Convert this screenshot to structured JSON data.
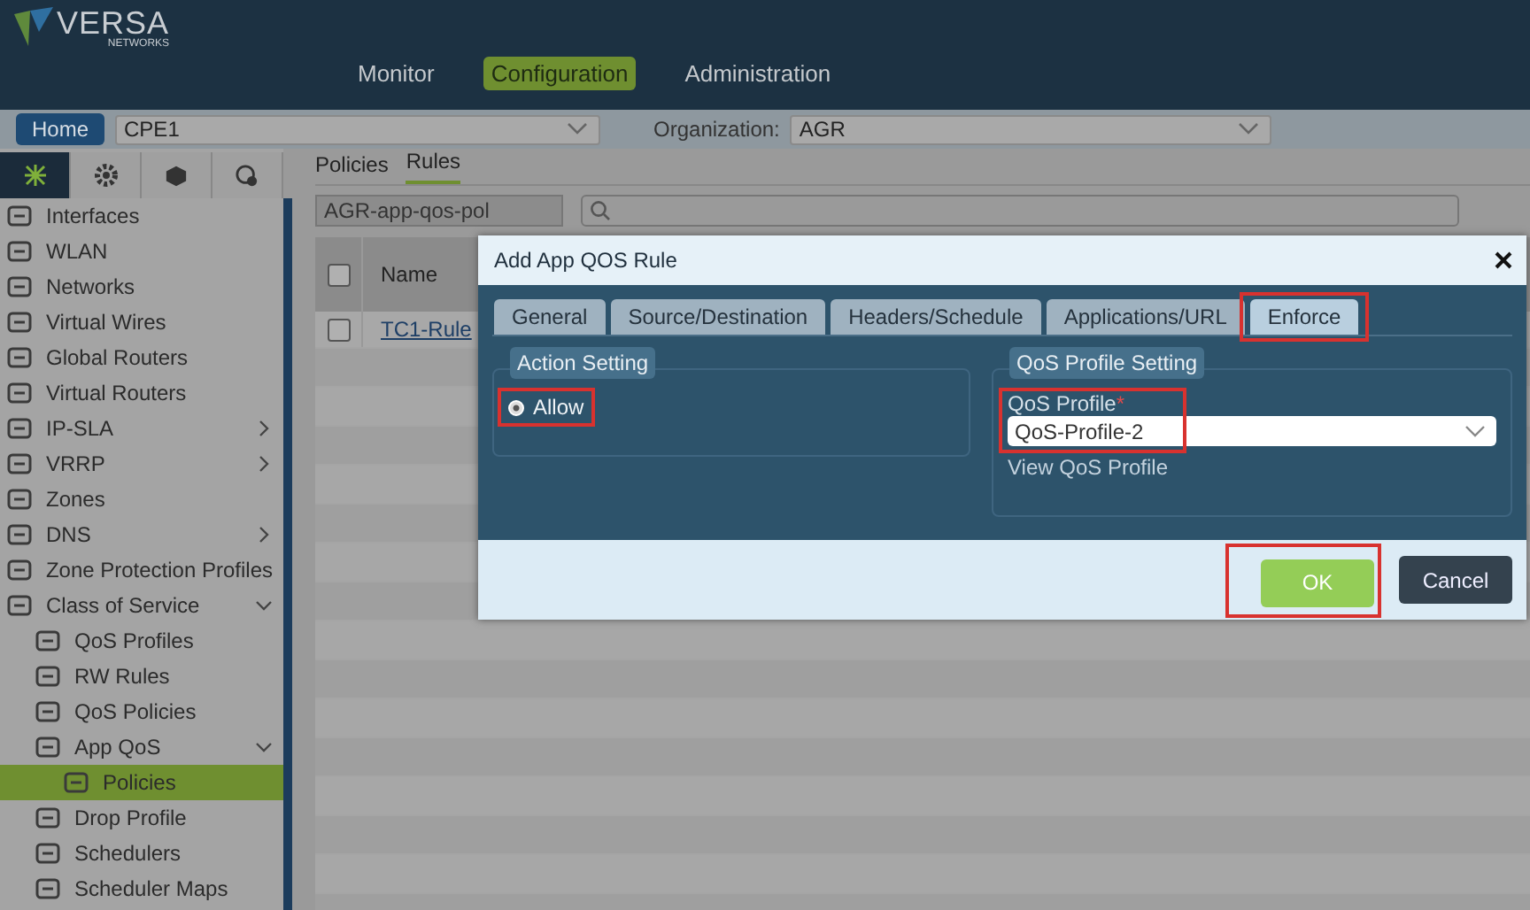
{
  "logo": {
    "name": "VERSA",
    "tagline": "NETWORKS"
  },
  "nav": [
    {
      "label": "Monitor",
      "selected": false
    },
    {
      "label": "Configuration",
      "selected": true
    },
    {
      "label": "Administration",
      "selected": false
    }
  ],
  "toolbar": {
    "home": "Home",
    "device": "CPE1",
    "organization_label": "Organization:",
    "organization": "AGR"
  },
  "sidebar": {
    "icon_tabs": [
      {
        "selected": true
      },
      {
        "selected": false
      },
      {
        "selected": false
      },
      {
        "selected": false
      }
    ],
    "items": [
      {
        "label": "Interfaces",
        "selected": false
      },
      {
        "label": "WLAN",
        "selected": false
      },
      {
        "label": "Networks",
        "selected": false
      },
      {
        "label": "Virtual Wires",
        "selected": false
      },
      {
        "label": "Global Routers",
        "selected": false
      },
      {
        "label": "Virtual Routers",
        "selected": false
      },
      {
        "label": "IP-SLA",
        "selected": false,
        "expanded": false
      },
      {
        "label": "VRRP",
        "selected": false,
        "expanded": false
      },
      {
        "label": "Zones",
        "selected": false
      },
      {
        "label": "DNS",
        "selected": false,
        "expanded": false
      },
      {
        "label": "Zone Protection Profiles",
        "selected": false
      },
      {
        "label": "Class of Service",
        "selected": false,
        "expanded": true,
        "children": [
          {
            "label": "QoS Profiles",
            "selected": false
          },
          {
            "label": "RW Rules",
            "selected": false
          },
          {
            "label": "QoS Policies",
            "selected": false
          },
          {
            "label": "App QoS",
            "selected": false,
            "expanded": true,
            "children": [
              {
                "label": "Policies",
                "selected": true
              }
            ]
          },
          {
            "label": "Drop Profile",
            "selected": false
          },
          {
            "label": "Schedulers",
            "selected": false
          },
          {
            "label": "Scheduler Maps",
            "selected": false
          }
        ]
      }
    ]
  },
  "content": {
    "tabs": [
      {
        "label": "Policies",
        "selected": false
      },
      {
        "label": "Rules",
        "selected": true
      }
    ],
    "policy_select": "AGR-app-qos-pol",
    "table": {
      "select_all_checked": false,
      "columns": [
        "Name"
      ],
      "rows": [
        {
          "name": "TC1-Rule",
          "checked": false
        }
      ]
    }
  },
  "dialog": {
    "title": "Add App QOS Rule",
    "tabs": [
      {
        "label": "General",
        "selected": false,
        "highlighted": false
      },
      {
        "label": "Source/Destination",
        "selected": false,
        "highlighted": false
      },
      {
        "label": "Headers/Schedule",
        "selected": false,
        "highlighted": false
      },
      {
        "label": "Applications/URL",
        "selected": false,
        "highlighted": false
      },
      {
        "label": "Enforce",
        "selected": true,
        "highlighted": true
      }
    ],
    "action_setting": {
      "title": "Action Setting",
      "option": {
        "label": "Allow",
        "checked": true,
        "highlighted": true
      }
    },
    "qos_setting": {
      "title": "QoS Profile Setting",
      "field_label": "QoS Profile",
      "required_mark": "*",
      "value": "QoS-Profile-2",
      "highlighted": true,
      "link": "View QoS Profile"
    },
    "buttons": [
      {
        "label": "OK",
        "kind": "primary",
        "highlighted": true
      },
      {
        "label": "Cancel",
        "kind": "secondary",
        "highlighted": false
      }
    ]
  }
}
